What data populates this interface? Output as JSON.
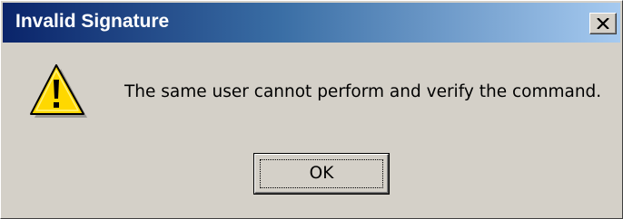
{
  "window": {
    "title": "Invalid Signature",
    "close_icon": "close-x-icon"
  },
  "message": {
    "icon": "warning-icon",
    "text": "The same user cannot perform and verify the command."
  },
  "buttons": {
    "ok_label": "OK"
  },
  "colors": {
    "dialog_background": "#d4d0c8",
    "titlebar_start": "#0a246a",
    "titlebar_end": "#a6caf0",
    "warning_yellow": "#ffd800"
  }
}
